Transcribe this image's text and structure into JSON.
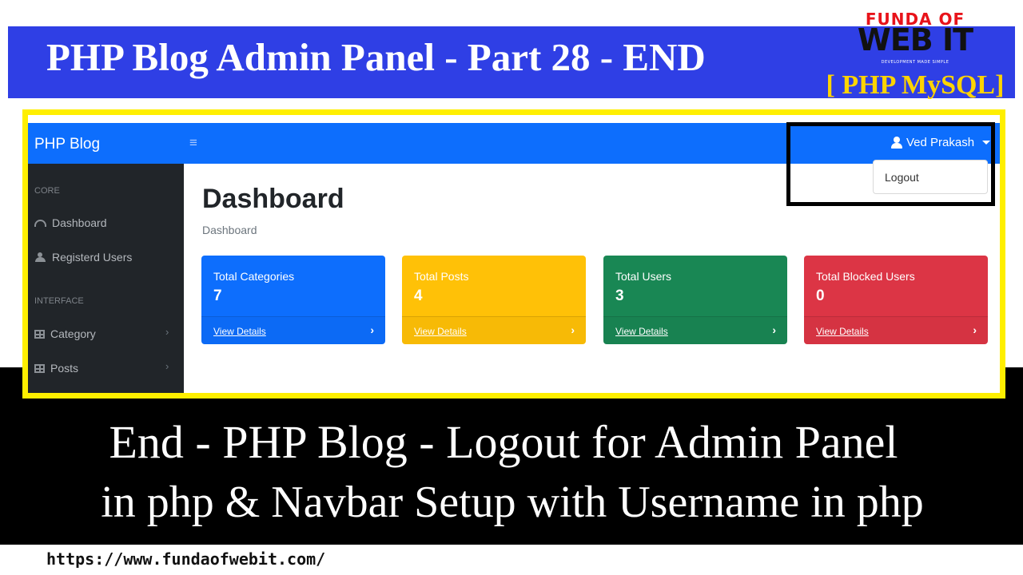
{
  "banner": {
    "title": "PHP Blog Admin Panel - Part 28 - END",
    "brand_line1": "FUNDA OF",
    "brand_line2": "WEB IT",
    "brand_tagline": "DEVELOPMENT MADE SIMPLE",
    "brand_line3": "[ PHP MySQL]",
    "colors": {
      "banner_bg": "#2f3fe5",
      "frame": "#ffef00"
    }
  },
  "app": {
    "navbar": {
      "brand": "PHP Blog",
      "toggle_icon": "≡",
      "user_name": "Ved Prakash",
      "dropdown_item": "Logout"
    },
    "sidebar": {
      "core_heading": "CORE",
      "interface_heading": "INTERFACE",
      "items": [
        {
          "label": "Dashboard",
          "icon": "gauge-icon"
        },
        {
          "label": "Registerd Users",
          "icon": "users-icon"
        },
        {
          "label": "Category",
          "icon": "table-icon",
          "chevron": "›"
        },
        {
          "label": "Posts",
          "icon": "table-icon",
          "chevron": "›"
        }
      ]
    },
    "main": {
      "title": "Dashboard",
      "breadcrumb": "Dashboard",
      "cards": [
        {
          "label": "Total Categories",
          "value": "7",
          "link": "View Details",
          "arrow": "›",
          "color": "#0d6efd"
        },
        {
          "label": "Total Posts",
          "value": "4",
          "link": "View Details",
          "arrow": "›",
          "color": "#ffc107"
        },
        {
          "label": "Total Users",
          "value": "3",
          "link": "View Details",
          "arrow": "›",
          "color": "#198754"
        },
        {
          "label": "Total Blocked Users",
          "value": "0",
          "link": "View Details",
          "arrow": "›",
          "color": "#dc3545"
        }
      ]
    }
  },
  "captions": {
    "line1": "End - PHP Blog - Logout for Admin Panel",
    "line2": "in php & Navbar Setup with Username in php",
    "url": "https://www.fundaofwebit.com/"
  }
}
